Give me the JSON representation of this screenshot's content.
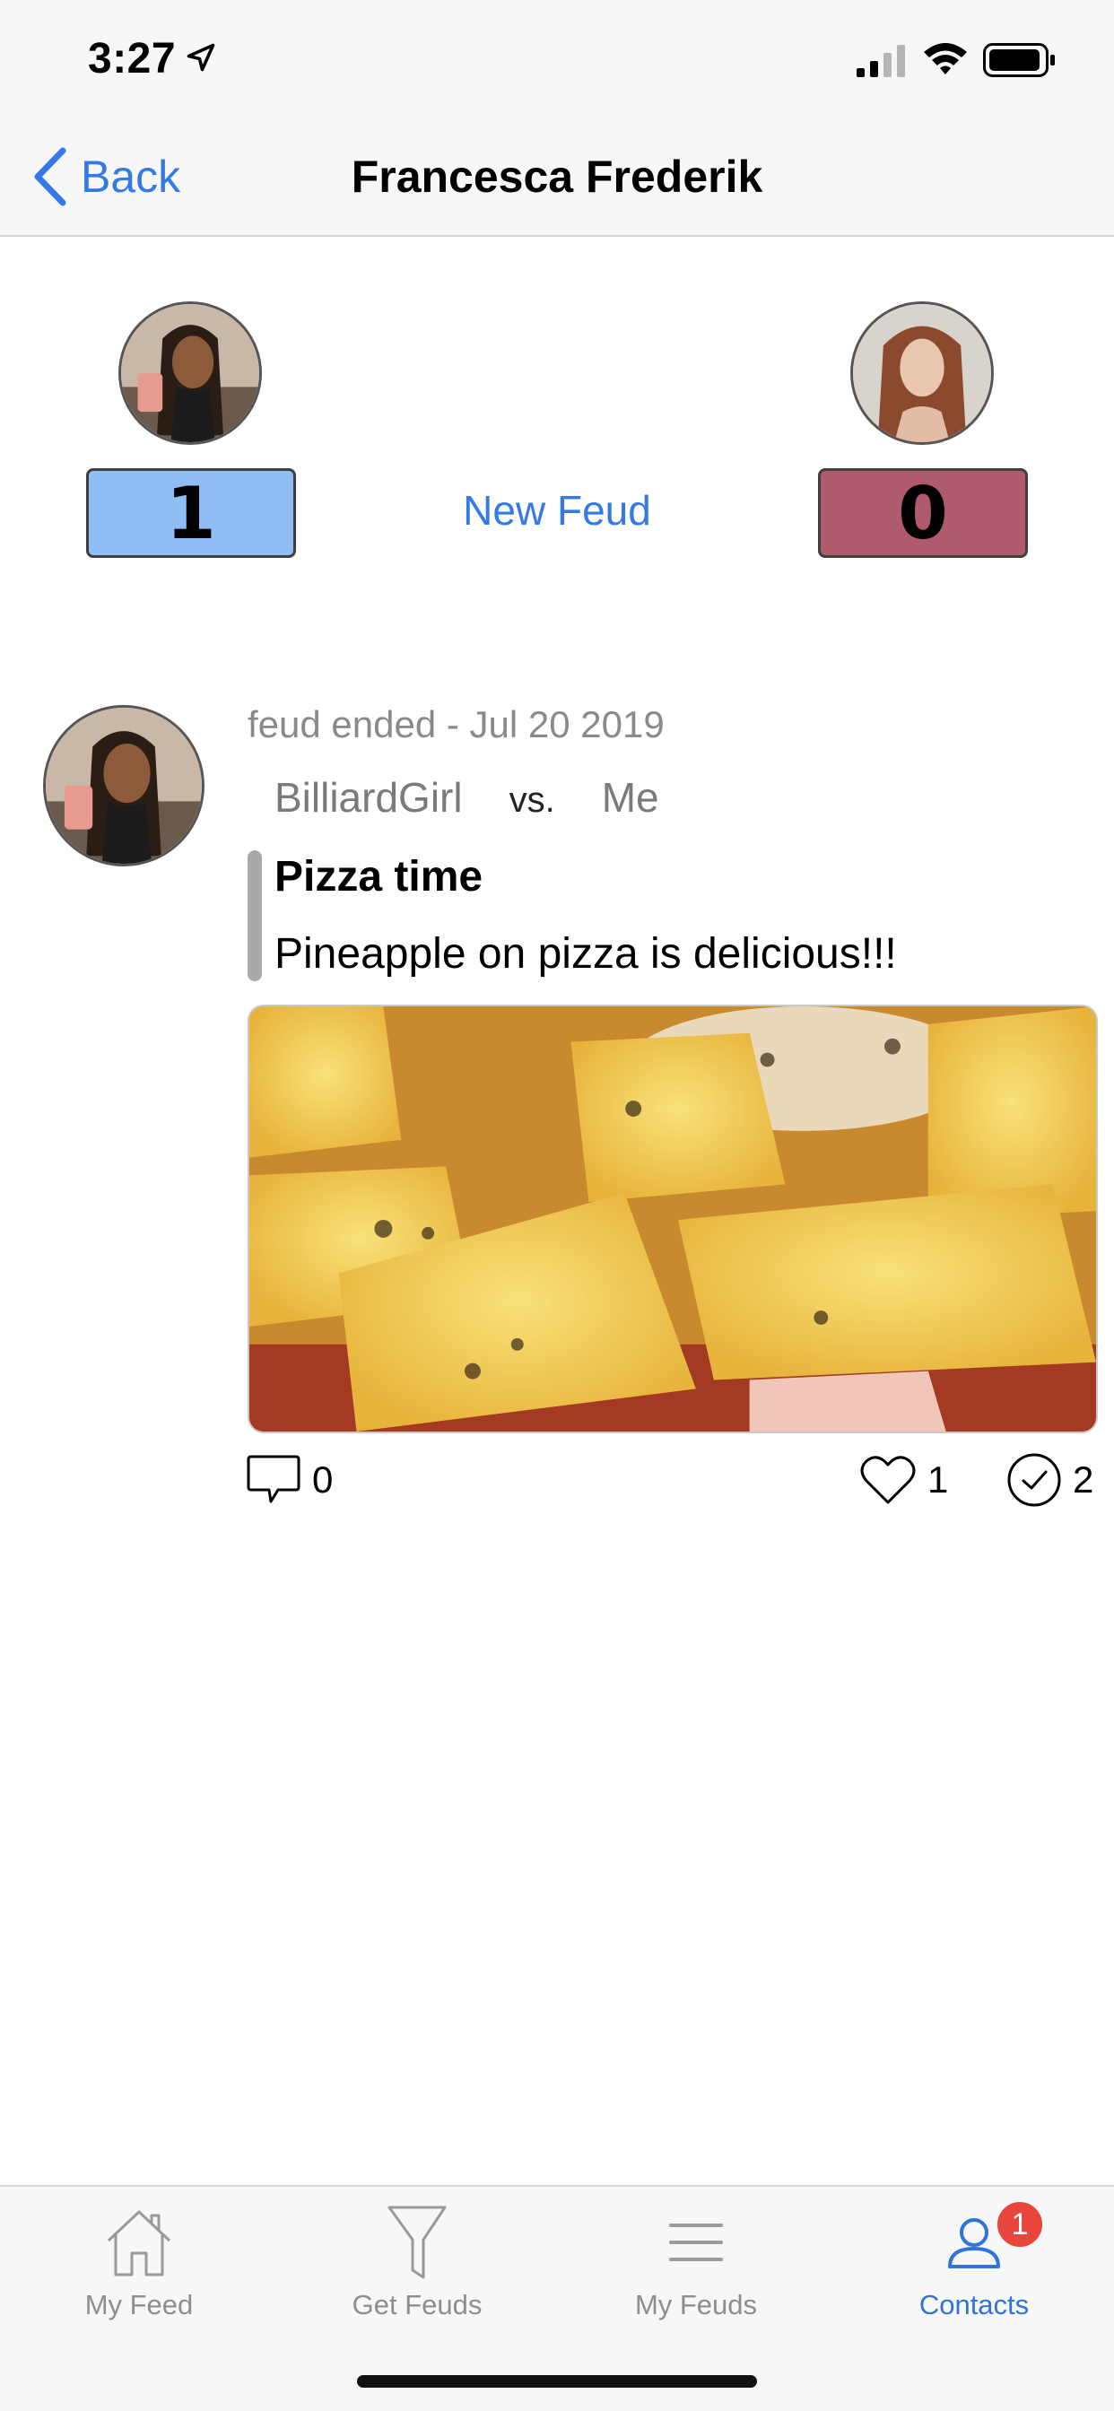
{
  "status_bar": {
    "time": "3:27"
  },
  "nav": {
    "back_label": "Back",
    "title": "Francesca Frederik"
  },
  "scoreboard": {
    "left_score": "1",
    "right_score": "0",
    "new_feud_label": "New Feud"
  },
  "post": {
    "meta": "feud ended - Jul 20 2019",
    "player1": "BilliardGirl",
    "vs": "vs.",
    "player2": "Me",
    "title": "Pizza time",
    "body": "Pineapple on pizza is delicious!!!",
    "comments": "0",
    "likes": "1",
    "checks": "2"
  },
  "tabs": [
    {
      "label": "My Feed",
      "icon": "home-icon"
    },
    {
      "label": "Get Feuds",
      "icon": "funnel-icon"
    },
    {
      "label": "My Feuds",
      "icon": "menu-lines-icon"
    },
    {
      "label": "Contacts",
      "icon": "person-icon",
      "badge": "1",
      "active": true
    }
  ],
  "colors": {
    "accent": "#3479e7",
    "left_score_bg": "#8fbef4",
    "right_score_bg": "#b05a6e",
    "badge": "#e8463c"
  }
}
